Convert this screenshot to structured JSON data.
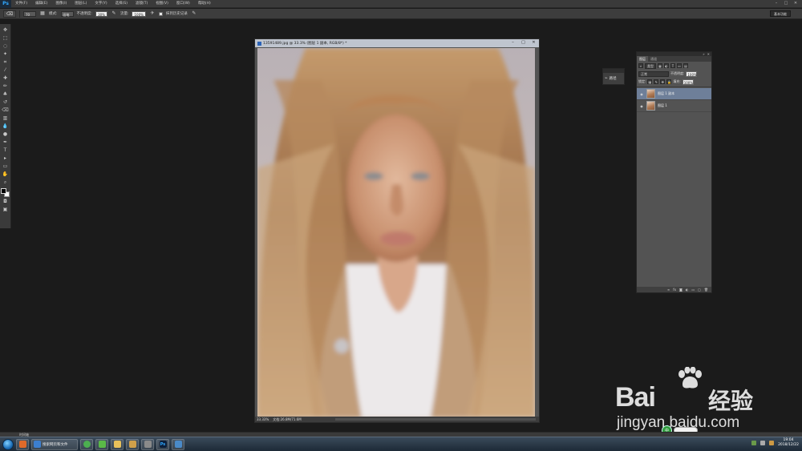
{
  "app": {
    "logo": "Ps",
    "menu": [
      "文件(F)",
      "编辑(E)",
      "图像(I)",
      "图层(L)",
      "文字(Y)",
      "选择(S)",
      "滤镜(T)",
      "视图(V)",
      "窗口(W)",
      "帮助(H)"
    ],
    "workspace": "基本功能"
  },
  "options": {
    "tool_icon": "eraser-icon",
    "brush_size": "70",
    "mode_label": "模式:",
    "mode_value": "画笔",
    "opacity_label": "不透明度:",
    "opacity_value": "30%",
    "flow_label": "流量:",
    "flow_value": "100%",
    "history_label": "抹到历史记录"
  },
  "document": {
    "title": "13591489.jpg @ 33.3% (图层 1 副本, RGB/8*) *",
    "zoom": "33.33%",
    "doc_size": "文档:26.8M/71.6M"
  },
  "paths_panel": {
    "label": "路径",
    "icon": "paths-icon"
  },
  "layers_panel": {
    "tabs": [
      "图层",
      "通道"
    ],
    "kind_label": "类型",
    "blend_mode": "正常",
    "opacity_label": "不透明度:",
    "opacity_value": "100%",
    "lock_label": "锁定:",
    "fill_label": "填充:",
    "fill_value": "100%",
    "layers": [
      {
        "name": "图层 1 副本",
        "selected": true
      },
      {
        "name": "图层 1",
        "selected": false
      }
    ]
  },
  "watermark": {
    "brand_latin": "Bai",
    "brand_cn": "经验",
    "url": "jingyan.baidu.com"
  },
  "status_bar": {
    "text": "时间轴"
  },
  "taskbar": {
    "task_label": "搜索网页和文件",
    "clock_time": "19:04",
    "clock_date": "2018/12/22"
  },
  "colors": {
    "accent": "#31a8ff",
    "selected_layer": "#6e7f99",
    "workspace_bg": "#1b1b1b"
  }
}
